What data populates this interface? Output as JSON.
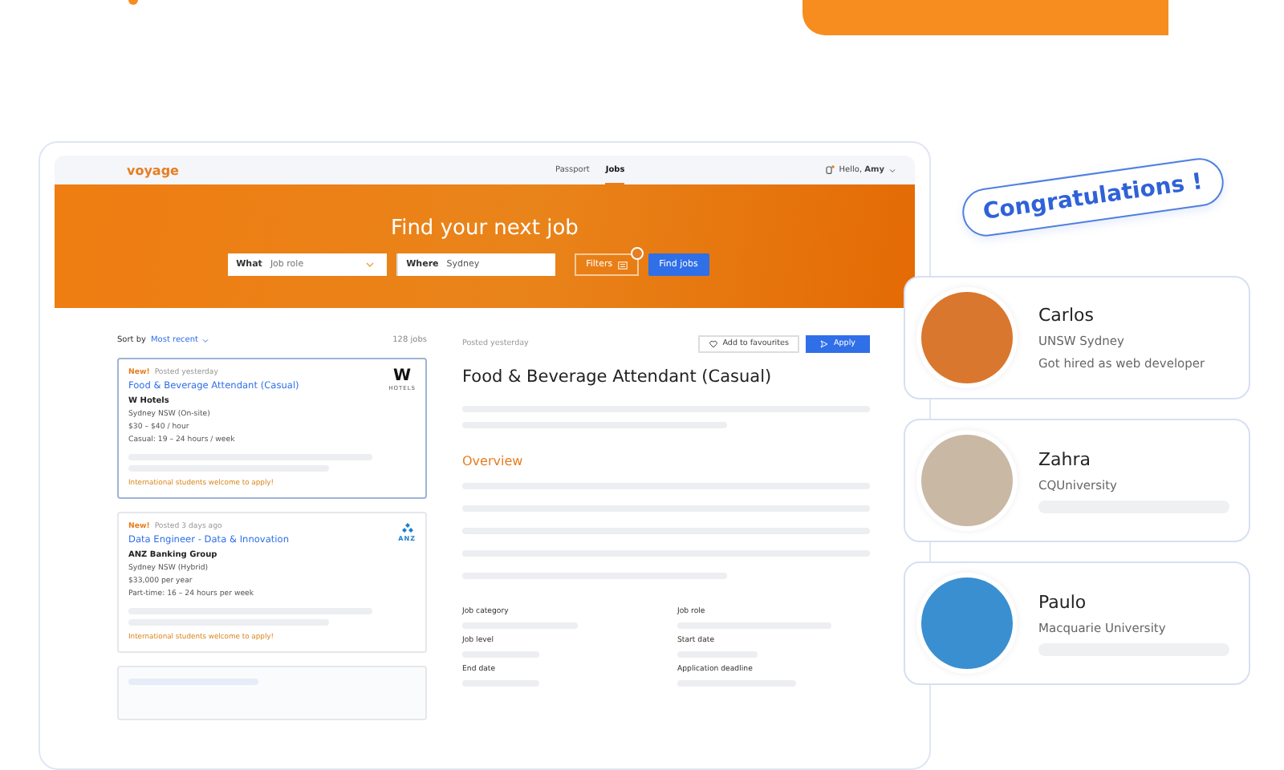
{
  "nav": {
    "logo": "voyage",
    "tabs": [
      {
        "label": "Passport",
        "selected": false
      },
      {
        "label": "Jobs",
        "selected": true
      }
    ],
    "greeting": "Hello,",
    "user": "Amy"
  },
  "hero": {
    "title": "Find your next job",
    "what_label": "What",
    "what_placeholder": "Job role",
    "where_label": "Where",
    "where_value": "Sydney",
    "filters": "Filters",
    "find_button": "Find jobs"
  },
  "results": {
    "sort_label": "Sort by",
    "sort_value": "Most recent",
    "count": "128 jobs",
    "jobs": [
      {
        "selected": true,
        "badge": "New!",
        "posted": "Posted yesterday",
        "title": "Food & Beverage Attendant (Casual)",
        "company": "W Hotels",
        "details": [
          "Sydney NSW (On-site)",
          "$30 – $40 / hour",
          "Casual: 19 – 24 hours / week"
        ],
        "note": "International students welcome to apply!",
        "logo": {
          "kind": "wordmark",
          "mark": "W",
          "caption": "HOTELS"
        }
      },
      {
        "selected": false,
        "badge": "New!",
        "posted": "Posted 3 days ago",
        "title": "Data Engineer - Data & Innovation",
        "company": "ANZ Banking Group",
        "details": [
          "Sydney NSW (Hybrid)",
          "$33,000 per year",
          "Part-time: 16 – 24 hours per week"
        ],
        "note": "International students welcome to apply!",
        "logo": {
          "kind": "emblem",
          "caption": "ANZ"
        }
      }
    ]
  },
  "detail": {
    "posted": "Posted yesterday",
    "favourite_button": "Add to favourites",
    "apply_button": "Apply",
    "title": "Food & Beverage Attendant (Casual)",
    "section": "Overview",
    "fields": [
      "Job category",
      "Job role",
      "Job level",
      "Start date",
      "End date",
      "Application deadline"
    ]
  },
  "congrats": "Congratulations !",
  "people": [
    {
      "name": "Carlos",
      "school": "UNSW Sydney",
      "note": "Got hired as web developer",
      "color": "#d9772e"
    },
    {
      "name": "Zahra",
      "school": "CQUniversity",
      "color": "#c9b8a4"
    },
    {
      "name": "Paulo",
      "school": "Macquarie University",
      "color": "#3a8fd0"
    }
  ]
}
